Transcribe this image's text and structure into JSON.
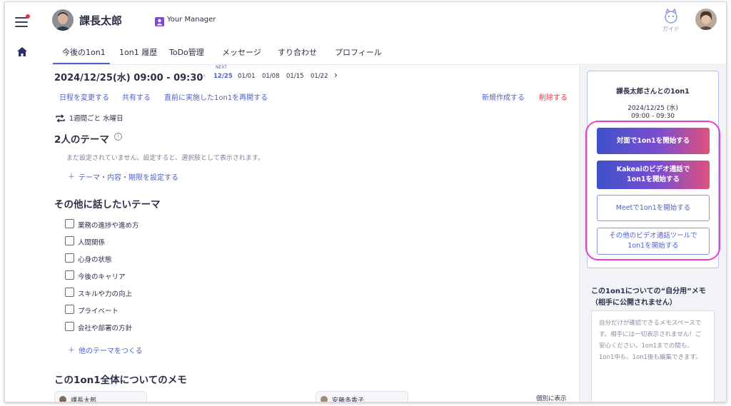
{
  "header": {
    "user_name": "課長太郎",
    "manager_badge": "Your Manager",
    "guide_label": "ガイド"
  },
  "tabs": [
    "今後の1on1",
    "1on1 履歴",
    "ToDo管理",
    "メッセージ",
    "すり合わせ",
    "プロフィール"
  ],
  "active_tab": 0,
  "schedule": {
    "current": "2024/12/25(水) 09:00 - 09:30",
    "next_label": "NEXT",
    "dates": [
      "12/25",
      "01/01",
      "01/08",
      "01/15",
      "01/22"
    ]
  },
  "actions": {
    "reschedule": "日程を変更する",
    "share": "共有する",
    "resume": "直前に実施した1on1を再開する",
    "new": "新規作成する",
    "delete": "削除する"
  },
  "recurrence": "1週間ごと 水曜日",
  "themes": {
    "title": "2人のテーマ",
    "empty_text": "まだ設定されていません。設定すると、選択肢として表示されます。",
    "add_link": "テーマ・内容・期限を設定する"
  },
  "other_topics": {
    "title": "その他に話したいテーマ",
    "items": [
      "業務の進捗や進め方",
      "人間関係",
      "心身の状態",
      "今後のキャリア",
      "スキルや力の向上",
      "プライベート",
      "会社や部署の方針"
    ],
    "add_link": "他のテーマをつくる"
  },
  "memo_section": {
    "title": "この1on1全体についてのメモ",
    "left_chip": "課長太郎",
    "right_chip": "安藤多香子",
    "individual_label": "個別に表示"
  },
  "side_card": {
    "title": "課長太郎さんとの1on1",
    "date": "2024/12/25 (水)",
    "time": "09:00 - 09:30",
    "btn_face": "対面で1on1を開始する",
    "btn_video_line1": "Kakeaiのビデオ通話で",
    "btn_video_line2": "1on1を開始する",
    "btn_meet": "Meetで1on1を開始する",
    "btn_other_line1": "その他のビデオ通話ツールで",
    "btn_other_line2": "1on1を開始する"
  },
  "private_memo": {
    "title_line1": "この1on1についての“自分用”メモ",
    "title_line2": "（相手に公開されません）",
    "placeholder": "自分だけが確認できるメモスペースです。相手には一切表示されません！ご安心ください。1on1までの間も、1on1中も、1on1後も編集できます。"
  },
  "colors": {
    "accent": "#4f62c9",
    "delete": "#e5334a",
    "highlight": "#ec3fc7",
    "gradient_start": "#3f51c9",
    "gradient_end": "#e0517e"
  }
}
